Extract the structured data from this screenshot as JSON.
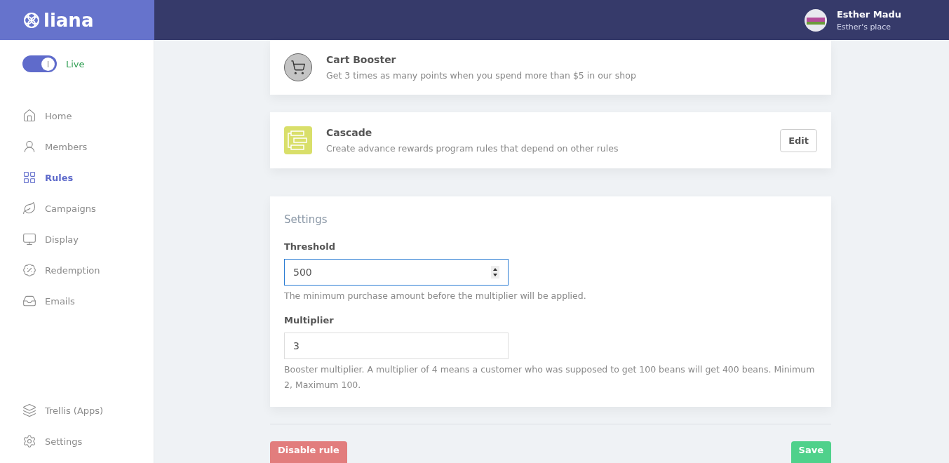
{
  "brand": {
    "name": "liana"
  },
  "user": {
    "name": "Esther Madu",
    "place": "Esther's place"
  },
  "live_toggle": {
    "on": true,
    "label": "Live"
  },
  "nav": [
    {
      "label": "Home",
      "selected": false
    },
    {
      "label": "Members",
      "selected": false
    },
    {
      "label": "Rules",
      "selected": true
    },
    {
      "label": "Campaigns",
      "selected": false
    },
    {
      "label": "Display",
      "selected": false
    },
    {
      "label": "Redemption",
      "selected": false
    },
    {
      "label": "Emails",
      "selected": false
    }
  ],
  "nav_bottom": [
    {
      "label": "Trellis (Apps)",
      "selected": false
    },
    {
      "label": "Settings",
      "selected": false
    }
  ],
  "rules": [
    {
      "kind": "cart",
      "title": "Cart Booster",
      "description": "Get 3 times as many points when you spend more than $5 in our shop"
    },
    {
      "kind": "cascade",
      "title": "Cascade",
      "description": "Create advance rewards program rules that depend on other rules",
      "edit": "Edit"
    }
  ],
  "settings": {
    "title": "Settings",
    "fields": [
      {
        "label": "Threshold",
        "value": "500",
        "focused": true,
        "help": "The minimum purchase amount before the multiplier will be applied."
      },
      {
        "label": "Multiplier",
        "value": "3",
        "focused": false,
        "help": "Booster multiplier. A multiplier of 4 means a customer who was supposed to get 100 beans will get 400 beans. Minimum 2, Maximum 100."
      }
    ]
  },
  "actions": {
    "disable": "Disable rule",
    "save": "Save"
  }
}
